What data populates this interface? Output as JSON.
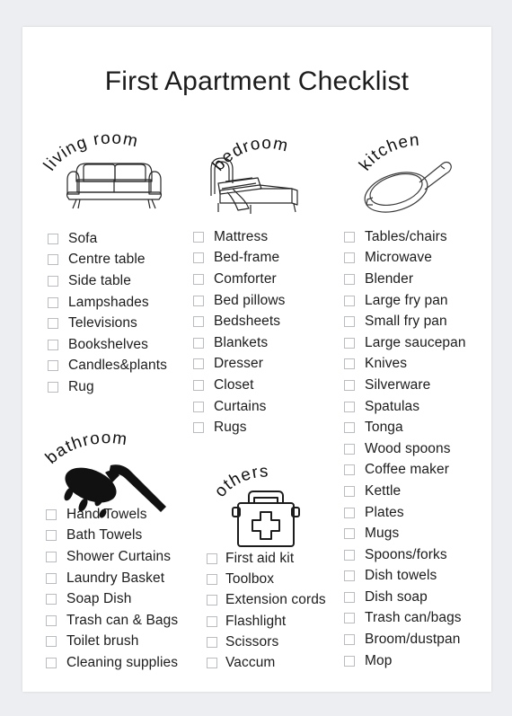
{
  "page": {
    "title": "First Apartment Checklist",
    "background_color": "#eceef1",
    "paper_color": "#ffffff",
    "text_color": "#1c1c1c",
    "checkbox_border_color": "#b9bcc1"
  },
  "sections": [
    {
      "id": "living-room",
      "heading": "living room",
      "icon": "sofa-icon",
      "items": [
        "Sofa",
        "Centre table",
        "Side table",
        "Lampshades",
        "Televisions",
        "Bookshelves",
        "Candles&plants",
        "Rug"
      ]
    },
    {
      "id": "bedroom",
      "heading": "bedroom",
      "icon": "bed-icon",
      "items": [
        "Mattress",
        "Bed-frame",
        "Comforter",
        "Bed pillows",
        "Bedsheets",
        "Blankets",
        "Dresser",
        "Closet",
        "Curtains",
        "Rugs"
      ]
    },
    {
      "id": "kitchen",
      "heading": "kitchen",
      "icon": "frying-pan-icon",
      "items": [
        "Tables/chairs",
        "Microwave",
        "Blender",
        "Large fry pan",
        "Small fry pan",
        "Large saucepan",
        "Knives",
        "Silverware",
        "Spatulas",
        "Tonga",
        "Wood spoons",
        "Coffee maker",
        "Kettle",
        "Plates",
        "Mugs",
        "Spoons/forks",
        "Dish towels",
        "Dish soap",
        "Trash can/bags",
        "Broom/dustpan",
        "Mop"
      ]
    },
    {
      "id": "bathroom",
      "heading": "bathroom",
      "icon": "shower-head-icon",
      "items": [
        "Hand Towels",
        "Bath Towels",
        "Shower Curtains",
        "Laundry Basket",
        "Soap Dish",
        "Trash can & Bags",
        "Toilet brush",
        "Cleaning supplies"
      ]
    },
    {
      "id": "others",
      "heading": "others",
      "icon": "first-aid-kit-icon",
      "items": [
        "First aid kit",
        "Toolbox",
        "Extension cords",
        "Flashlight",
        "Scissors",
        "Vaccum"
      ]
    }
  ]
}
